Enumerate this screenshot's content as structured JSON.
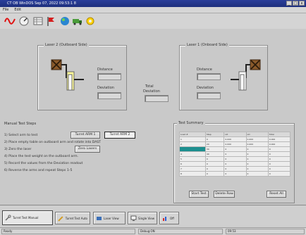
{
  "window": {
    "title": "CT OB WinDOS   Sep 07, 2022   09:53:1 8"
  },
  "menu": [
    "File",
    "Edit"
  ],
  "toolbar": {
    "icons": [
      "waveform-icon",
      "gauge-icon",
      "table-icon",
      "flag-icon",
      "paint-icon",
      "truck-icon",
      "gear-icon"
    ]
  },
  "left_panel": {
    "title": "Laser 2 (Outboard Side)",
    "distance_label": "Distance",
    "deviation_label": "Deviation"
  },
  "total": {
    "label_line1": "Total",
    "label_line2": "Deviation"
  },
  "right_panel": {
    "title": "Laser 1 (Onboard Side)",
    "distance_label": "Distance",
    "deviation_label": "Deviation"
  },
  "manual_steps": {
    "title": "Manual Test Steps",
    "steps": [
      "1)  Select arm to test",
      "2)  Place empty table on outboard arm and rotate into DAST",
      "3)  Zero the laser",
      "4)  Place the test weight on the outboard arm.",
      "5)  Record the values from the Deviation readout",
      "6)  Reverse the arms and repeat Steps 1-5"
    ],
    "arm1_button": "Turret ARM 1",
    "arm2_button": "Turret ARM 2",
    "zero_button": "Zero Lasers"
  },
  "summary": {
    "title": "Test Summary",
    "headers": [
      "Load #",
      "Step",
      "LD",
      "LD",
      "Total"
    ],
    "rows": [
      [
        "1",
        "0",
        "0.000",
        "0.000",
        "0.000"
      ],
      [
        "2",
        "20",
        "0.000",
        "0.000",
        "0.000"
      ],
      [
        "",
        "30",
        "0",
        "0",
        "0"
      ],
      [
        "4",
        "40",
        "0",
        "0",
        "0"
      ],
      [
        "5",
        "0",
        "0",
        "0",
        "0"
      ],
      [
        "6",
        "0",
        "0",
        "0",
        "0"
      ],
      [
        "7",
        "0",
        "0",
        "0",
        "0"
      ],
      [
        "8",
        "0",
        "0",
        "0",
        "0"
      ]
    ],
    "start_button": "Start Test",
    "delete_button": "Delete Row",
    "reset_button": "Reset All"
  },
  "tabs": [
    "Turret Test Manual",
    "Turret Test Auto",
    "Laser View",
    "Single View",
    "Off"
  ],
  "status": {
    "left": "Ready",
    "middle": "Debug:ON",
    "right": "09:53"
  }
}
